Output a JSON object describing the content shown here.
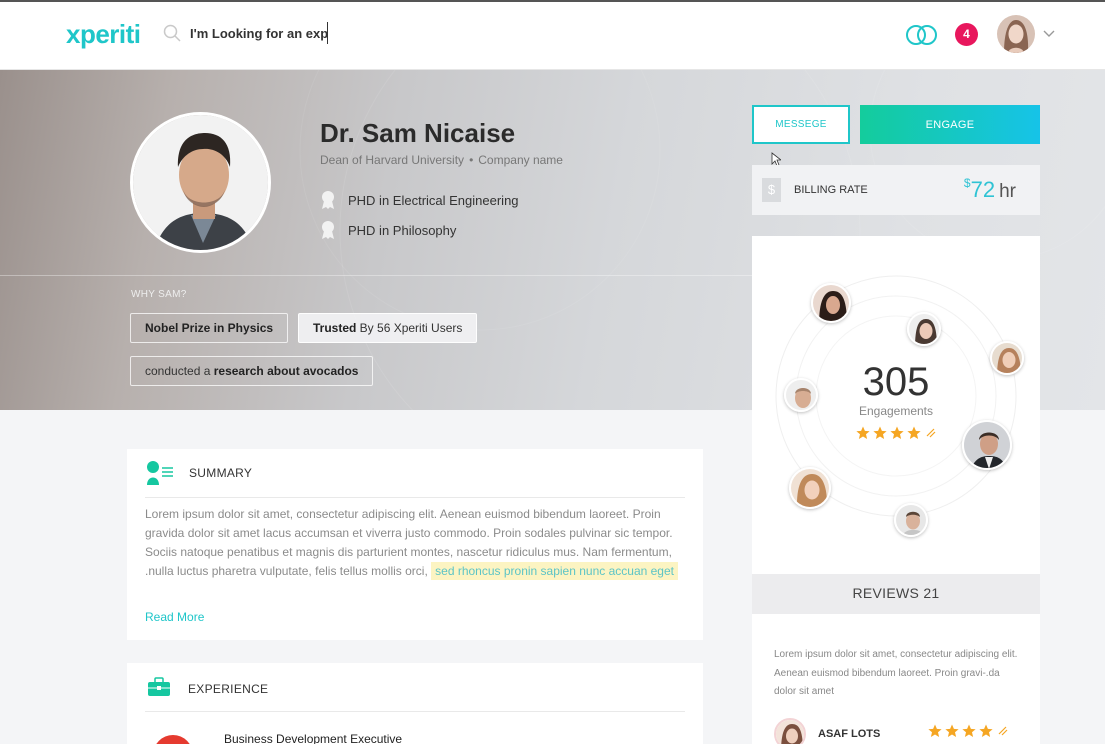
{
  "header": {
    "logo": "xperiti",
    "search_value": "I'm Looking for an exp",
    "notifications_count": "4"
  },
  "profile": {
    "name": "Dr. Sam Nicaise",
    "role": "Dean of Harvard University",
    "separator": "•",
    "company": "Company name",
    "degrees": [
      "PHD in Electrical Engineering",
      "PHD in Philosophy"
    ],
    "why_label": "WHY SAM?",
    "tags": [
      {
        "bold": "Nobel Prize in Physics",
        "rest": ""
      },
      {
        "bold": "Trusted",
        "rest": " By 56 Xperiti Users"
      },
      {
        "prefix": "conducted a ",
        "bold": "research about avocados"
      }
    ]
  },
  "actions": {
    "message_label": "MESSEGE",
    "engage_label": "ENGAGE"
  },
  "billing": {
    "label": "BILLING RATE",
    "currency": "$",
    "amount": "72",
    "unit": "hr"
  },
  "engagements": {
    "count": "305",
    "label": "Engagements",
    "rating": 4.5
  },
  "reviews": {
    "header": "REVIEWS 21",
    "text": "Lorem ipsum dolor sit amet, consectetur adipiscing elit. Aenean euismod bibendum laoreet. Proin gravi-.da dolor sit amet",
    "reviewer": "ASAF LOTS",
    "rating": 4.5
  },
  "summary": {
    "title": "SUMMARY",
    "text_plain": "Lorem ipsum dolor sit amet, consectetur adipiscing elit. Aenean euismod bibendum laoreet. Proin gravida dolor sit amet lacus accumsan et viverra justo commodo. Proin sodales pulvinar sic tempor. Sociis natoque penatibus et magnis dis parturient montes, nascetur ridiculus mus. Nam fermentum, .nulla luctus pharetra vulputate, felis tellus mollis orci, ",
    "text_highlight": "sed rhoncus pronin sapien nunc accuan eget",
    "read_more": "Read More"
  },
  "experience": {
    "title": "EXPERIENCE",
    "job_title": "Business Development Executive"
  },
  "colors": {
    "brand": "#1fc6c9",
    "notification": "#e8175d",
    "star": "#f5a623",
    "engage_gradient_start": "#14cc9c",
    "engage_gradient_end": "#16c3e8",
    "highlight": "#fcf4c2"
  }
}
